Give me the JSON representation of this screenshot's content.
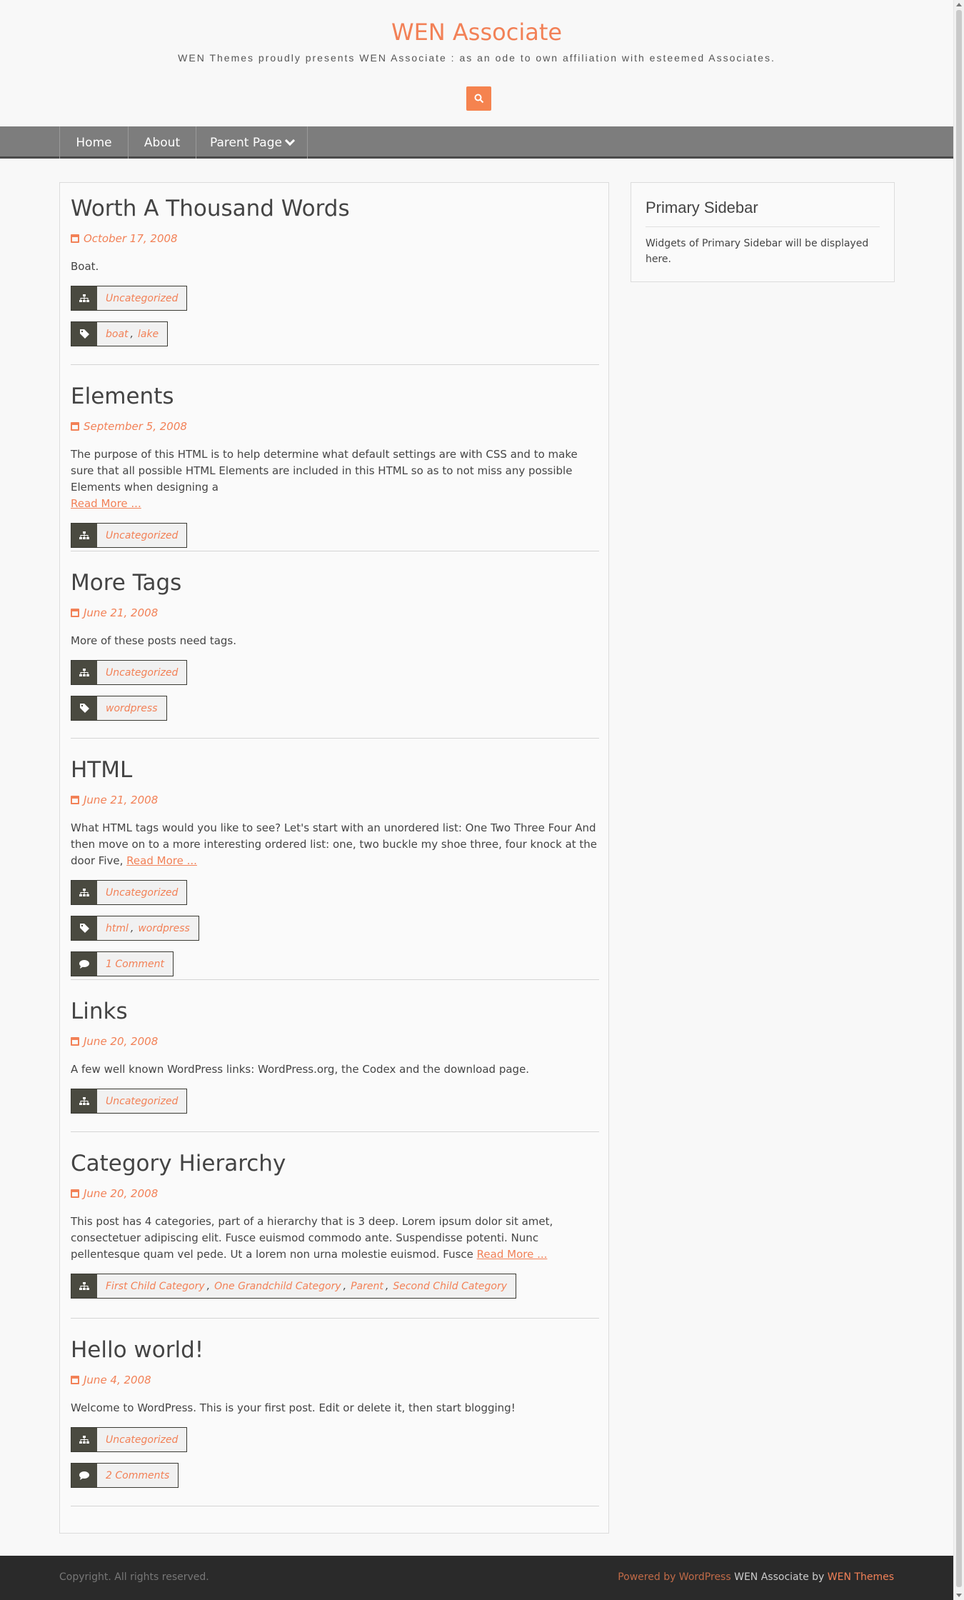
{
  "site": {
    "title": "WEN Associate",
    "description": "WEN Themes proudly presents WEN Associate : as an ode to own affiliation with esteemed Associates."
  },
  "search": {
    "icon": "search-icon"
  },
  "nav": {
    "items": [
      {
        "label": "Home"
      },
      {
        "label": "About"
      },
      {
        "label": "Parent Page",
        "has_dropdown": true
      }
    ]
  },
  "posts": [
    {
      "title": "Worth A Thousand Words",
      "date": "October 17, 2008",
      "excerpt": "Boat.",
      "read_more": "",
      "categories": [
        "Uncategorized"
      ],
      "tags": [
        "boat",
        "lake"
      ],
      "comments": ""
    },
    {
      "title": "Elements",
      "date": "September 5, 2008",
      "excerpt": "The purpose of this HTML is to help determine what default settings are with CSS and to make sure that all possible HTML Elements are included in this HTML so as to not miss any possible Elements when designing a",
      "read_more": "Read More ...",
      "categories": [
        "Uncategorized"
      ],
      "tags": [],
      "comments": ""
    },
    {
      "title": "More Tags",
      "date": "June 21, 2008",
      "excerpt": "More of these posts need tags.",
      "read_more": "",
      "categories": [
        "Uncategorized"
      ],
      "tags": [
        "wordpress"
      ],
      "comments": ""
    },
    {
      "title": "HTML",
      "date": "June 21, 2008",
      "excerpt": "What HTML tags would you like to see? Let's start with an unordered list: One Two Three Four And then move on to a more interesting ordered list: one, two buckle my shoe three, four knock at the door Five,",
      "read_more": "Read More ...",
      "categories": [
        "Uncategorized"
      ],
      "tags": [
        "html",
        "wordpress"
      ],
      "comments": "1 Comment"
    },
    {
      "title": "Links",
      "date": "June 20, 2008",
      "excerpt": "A few well known WordPress links: WordPress.org, the Codex and the download page.",
      "read_more": "",
      "categories": [
        "Uncategorized"
      ],
      "tags": [],
      "comments": ""
    },
    {
      "title": "Category Hierarchy",
      "date": "June 20, 2008",
      "excerpt": "This post has 4 categories, part of a hierarchy that is 3 deep. Lorem ipsum dolor sit amet, consectetuer adipiscing elit. Fusce euismod commodo ante. Suspendisse potenti. Nunc pellentesque quam vel pede. Ut a lorem non urna molestie euismod. Fusce",
      "read_more": "Read More ...",
      "categories": [
        "First Child Category",
        "One Grandchild Category",
        "Parent",
        "Second Child Category"
      ],
      "tags": [],
      "comments": ""
    },
    {
      "title": "Hello world!",
      "date": "June 4, 2008",
      "excerpt": "Welcome to WordPress. This is your first post. Edit or delete it, then start blogging!",
      "read_more": "",
      "categories": [
        "Uncategorized"
      ],
      "tags": [],
      "comments": "2 Comments"
    }
  ],
  "sidebar": {
    "title": "Primary Sidebar",
    "text": "Widgets of Primary Sidebar will be displayed here."
  },
  "footer": {
    "copyright": "Copyright. All rights reserved.",
    "powered_by": "Powered by WordPress",
    "theme_name": "WEN Associate by",
    "theme_author": "WEN Themes"
  },
  "colors": {
    "accent": "#f28157",
    "nav_bg": "#7d7d7d",
    "meta_icon_bg": "#4a4a40",
    "footer_bg": "#2a2a2a"
  }
}
